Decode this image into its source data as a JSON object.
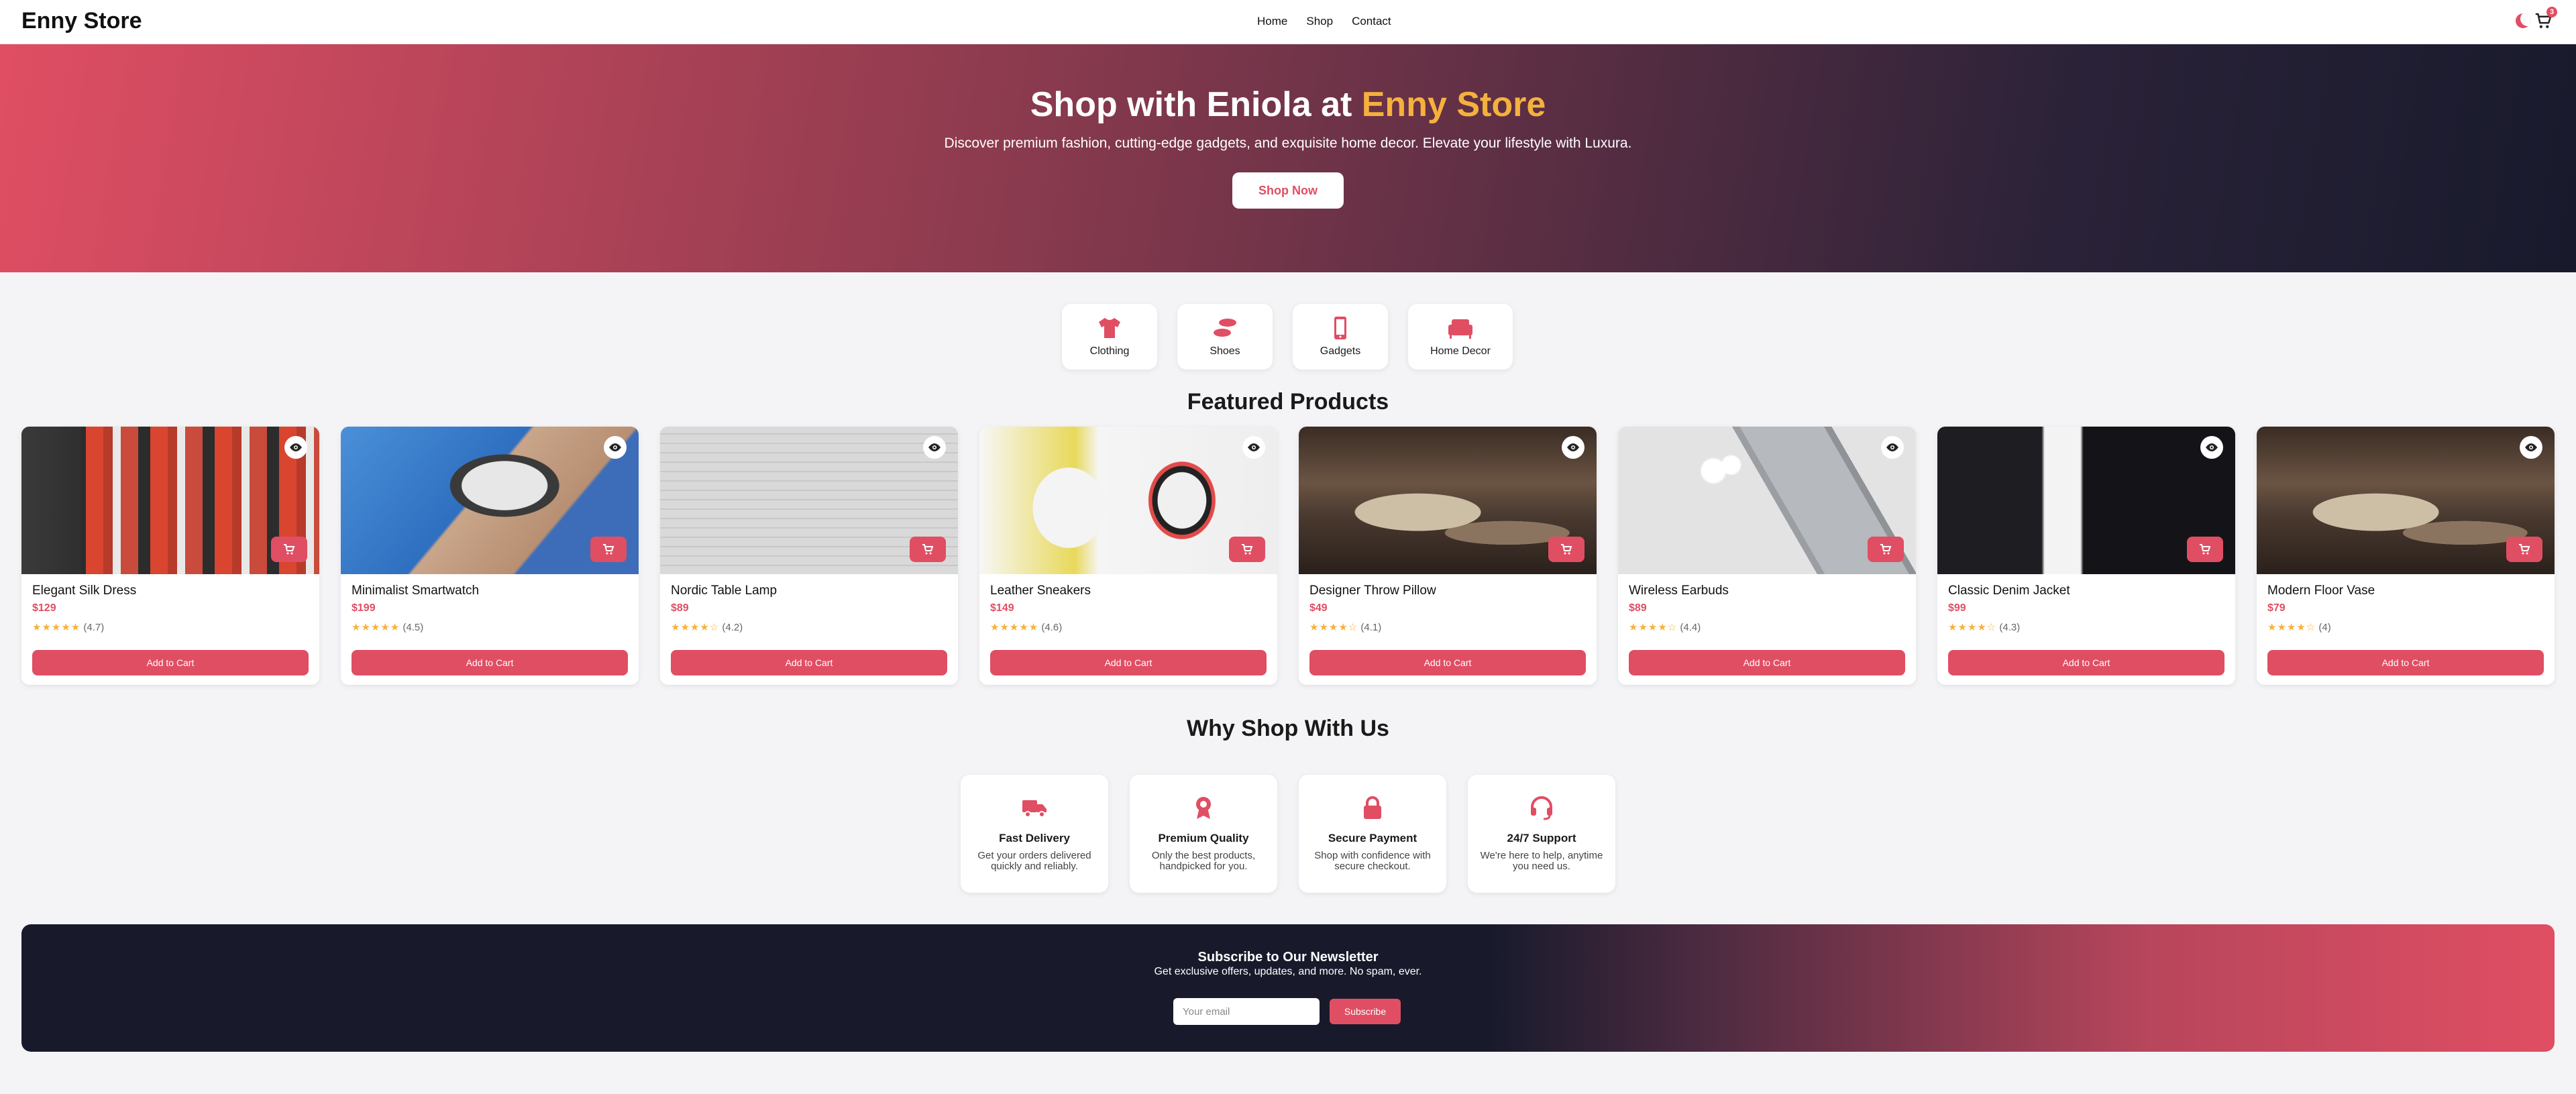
{
  "nav": {
    "brand": "Enny Store",
    "links": [
      "Home",
      "Shop",
      "Contact"
    ],
    "cart_count": "3",
    "icons": [
      "moon-icon",
      "cart-icon"
    ]
  },
  "hero": {
    "title_prefix": "Shop with Eniola at ",
    "title_accent": "Enny Store",
    "subtitle": "Discover premium fashion, cutting-edge gadgets, and exquisite home decor. Elevate your lifestyle with Luxura.",
    "cta": "Shop Now"
  },
  "categories": [
    {
      "label": "Clothing",
      "icon": "shirt-icon"
    },
    {
      "label": "Shoes",
      "icon": "shoe-icon"
    },
    {
      "label": "Gadgets",
      "icon": "phone-icon"
    },
    {
      "label": "Home Decor",
      "icon": "couch-icon"
    }
  ],
  "featured": {
    "title": "Featured Products",
    "add_label": "Add to Cart",
    "products": [
      {
        "name": "Elegant Silk Dress",
        "price": "$129",
        "rating": "(4.7)",
        "stars": "★★★★★",
        "image": "clothing-store-photo"
      },
      {
        "name": "Minimalist Smartwatch",
        "price": "$199",
        "rating": "(4.5)",
        "stars": "★★★★★",
        "image": "smartwatch-photo"
      },
      {
        "name": "Nordic Table Lamp",
        "price": "$89",
        "rating": "(4.2)",
        "stars": "★★★★☆",
        "image": "lamp-photo"
      },
      {
        "name": "Leather Sneakers",
        "price": "$149",
        "rating": "(4.6)",
        "stars": "★★★★★",
        "image": "sneakers-photo"
      },
      {
        "name": "Designer Throw Pillow",
        "price": "$49",
        "rating": "(4.1)",
        "stars": "★★★★☆",
        "image": "living-room-photo"
      },
      {
        "name": "Wireless Earbuds",
        "price": "$89",
        "rating": "(4.4)",
        "stars": "★★★★☆",
        "image": "phone-earbuds-photo"
      },
      {
        "name": "Classic Denim Jacket",
        "price": "$99",
        "rating": "(4.3)",
        "stars": "★★★★☆",
        "image": "jacket-photo"
      },
      {
        "name": "Modern Floor Vase",
        "price": "$79",
        "rating": "(4)",
        "stars": "★★★★☆",
        "image": "living-room-photo"
      }
    ]
  },
  "why": {
    "title": "Why Shop With Us",
    "items": [
      {
        "title": "Fast Delivery",
        "desc": "Get your orders delivered quickly and reliably.",
        "icon": "truck-icon"
      },
      {
        "title": "Premium Quality",
        "desc": "Only the best products, handpicked for you.",
        "icon": "award-icon"
      },
      {
        "title": "Secure Payment",
        "desc": "Shop with confidence with secure checkout.",
        "icon": "lock-icon"
      },
      {
        "title": "24/7 Support",
        "desc": "We're here to help, anytime you need us.",
        "icon": "headset-icon"
      }
    ]
  },
  "newsletter": {
    "title": "Subscribe to Our Newsletter",
    "subtitle": "Get exclusive offers, updates, and more. No spam, ever.",
    "placeholder": "Your email",
    "button": "Subscribe"
  },
  "colors": {
    "accent": "#e04e63",
    "gold": "#f5b13d",
    "dark": "#181a2c"
  }
}
